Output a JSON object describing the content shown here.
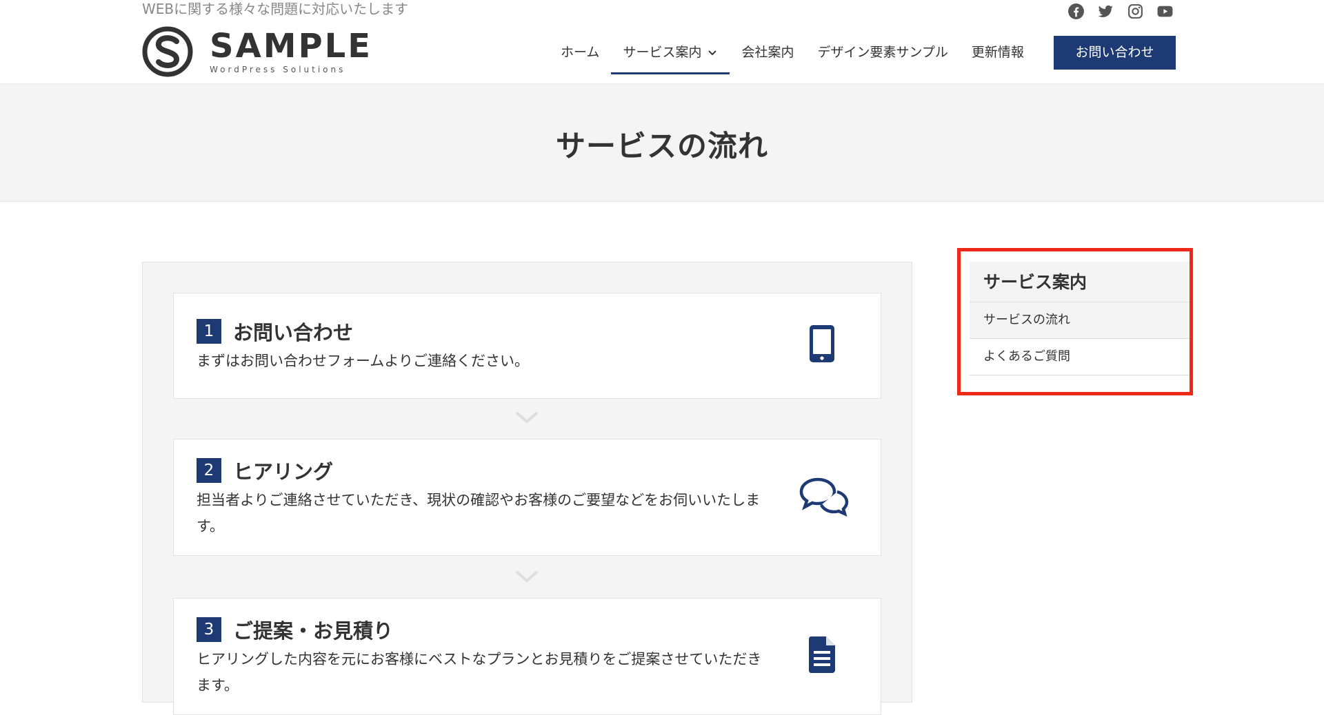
{
  "header": {
    "tagline": "WEBに関する様々な問題に対応いたします",
    "logo": {
      "title": "SAMPLE",
      "subtitle": "WordPress Solutions"
    },
    "social_icons": [
      "facebook-icon",
      "twitter-icon",
      "instagram-icon",
      "youtube-icon"
    ],
    "nav": {
      "items": [
        {
          "label": "ホーム"
        },
        {
          "label": "サービス案内",
          "active": true
        },
        {
          "label": "会社案内"
        },
        {
          "label": "デザイン要素サンプル"
        },
        {
          "label": "更新情報"
        }
      ],
      "contact_label": "お問い合わせ"
    }
  },
  "page": {
    "title": "サービスの流れ"
  },
  "steps": [
    {
      "number": "1",
      "title": "お問い合わせ",
      "text": "まずはお問い合わせフォームよりご連絡ください。",
      "icon": "smartphone-icon"
    },
    {
      "number": "2",
      "title": "ヒアリング",
      "text": "担当者よりご連絡させていただき、現状の確認やお客様のご要望などをお伺いいたします。",
      "icon": "chat-bubbles-icon"
    },
    {
      "number": "3",
      "title": "ご提案・お見積り",
      "text": "ヒアリングした内容を元にお客様にベストなプランとお見積りをご提案させていただきます。",
      "icon": "document-icon"
    }
  ],
  "sidebar": {
    "title": "サービス案内",
    "items": [
      {
        "label": "サービスの流れ",
        "current": true
      },
      {
        "label": "よくあるご質問"
      }
    ]
  },
  "colors": {
    "accent": "#1e3a74",
    "highlight": "#ee2a17",
    "band": "#f4f4f4"
  }
}
